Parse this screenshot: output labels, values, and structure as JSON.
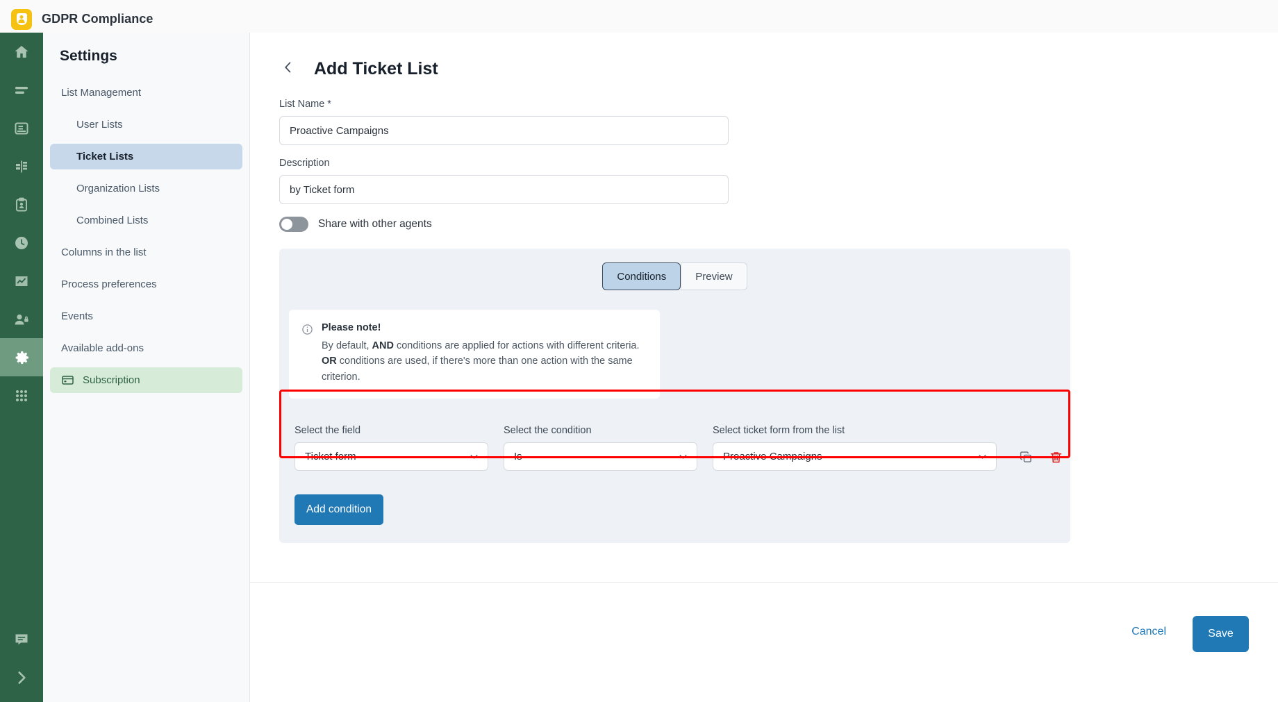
{
  "app": {
    "brand_title": "GDPR Compliance",
    "logo_icon": "gdpr-shield-logo"
  },
  "rail": {
    "items": [
      {
        "icon": "home-icon",
        "active": false
      },
      {
        "icon": "menu-lines-icon",
        "active": false
      },
      {
        "icon": "server-database-icon",
        "active": false
      },
      {
        "icon": "data-split-icon",
        "active": false
      },
      {
        "icon": "clipboard-user-icon",
        "active": false
      },
      {
        "icon": "clock-icon",
        "active": false
      },
      {
        "icon": "chart-line-icon",
        "active": false
      },
      {
        "icon": "user-lock-icon",
        "active": false
      },
      {
        "icon": "gear-icon",
        "active": true
      },
      {
        "icon": "grid-dots-icon",
        "active": false
      }
    ],
    "bottom_items": [
      {
        "icon": "chat-bubble-icon"
      },
      {
        "icon": "chevron-right-expand-icon"
      }
    ]
  },
  "sidebar": {
    "title": "Settings",
    "items": [
      {
        "label": "List Management",
        "level": 0,
        "state": "normal",
        "icon": null
      },
      {
        "label": "User Lists",
        "level": 1,
        "state": "normal",
        "icon": null
      },
      {
        "label": "Ticket Lists",
        "level": 1,
        "state": "selected",
        "icon": null
      },
      {
        "label": "Organization Lists",
        "level": 1,
        "state": "normal",
        "icon": null
      },
      {
        "label": "Combined Lists",
        "level": 1,
        "state": "normal",
        "icon": null
      },
      {
        "label": "Columns in the list",
        "level": 0,
        "state": "normal",
        "icon": null
      },
      {
        "label": "Process preferences",
        "level": 0,
        "state": "normal",
        "icon": null
      },
      {
        "label": "Events",
        "level": 0,
        "state": "normal",
        "icon": null
      },
      {
        "label": "Available add-ons",
        "level": 0,
        "state": "normal",
        "icon": null
      },
      {
        "label": "Subscription",
        "level": 0,
        "state": "green",
        "icon": "credit-card-icon"
      }
    ]
  },
  "main": {
    "back_icon": "chevron-left-icon",
    "page_title": "Add Ticket List",
    "list_name_label": "List Name *",
    "list_name_value": "Proactive Campaigns",
    "list_name_placeholder": "List name",
    "description_label": "Description",
    "description_value": "by Ticket form",
    "description_placeholder": "Description",
    "share_toggle_label": "Share with other agents",
    "share_toggle_state": "off",
    "tabs": [
      {
        "label": "Conditions",
        "active": true
      },
      {
        "label": "Preview",
        "active": false
      }
    ],
    "note": {
      "icon": "info-circle-icon",
      "title": "Please note!",
      "line1_pre": "By default, ",
      "line1_bold": "AND",
      "line1_post": " conditions are applied for actions with different criteria.",
      "line2_bold": "OR",
      "line2_post": " conditions are used, if there's more than one action with the same criterion."
    },
    "condition_row": {
      "field_label": "Select the field",
      "field_value": "Ticket form",
      "condition_label": "Select the condition",
      "condition_value": "Is",
      "value_label": "Select ticket form from the list",
      "value_value": "Proactive Campaigns",
      "copy_icon": "copy-icon",
      "delete_icon": "trash-icon",
      "highlight_color": "#ff0000"
    },
    "add_condition_label": "Add condition"
  },
  "footer": {
    "cancel_label": "Cancel",
    "save_label": "Save"
  },
  "colors": {
    "rail_green": "#2e6347",
    "rail_active_green": "#6f9b81",
    "brand_yellow": "#f5c211",
    "primary_blue": "#2079b5",
    "selected_nav_blue": "#c7d8ea",
    "subscription_green": "#d7ebd9",
    "panel_bg": "#eef2f7",
    "annotation_red": "#ff0000"
  }
}
